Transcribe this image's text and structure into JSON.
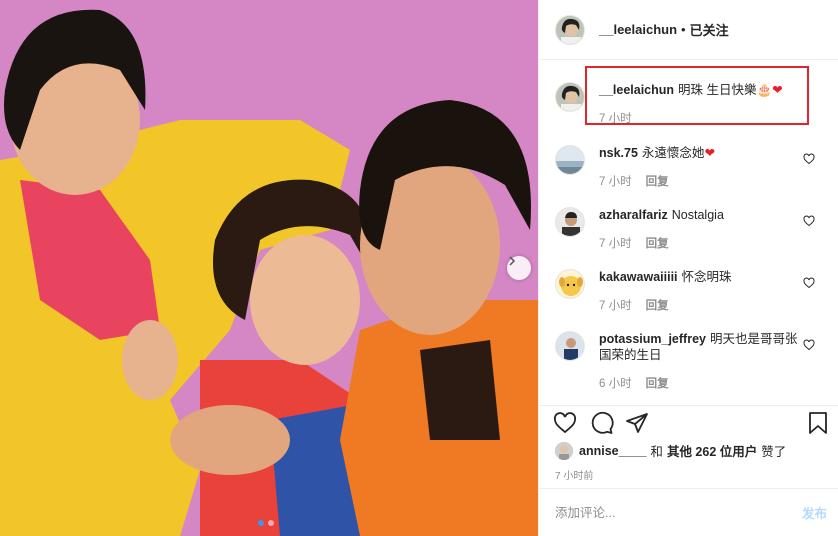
{
  "colors": {
    "accent": "#3897f0",
    "highlight_box": "#e0262b",
    "heart": "#ed1c24"
  },
  "photo": {
    "alt_icon": "photo-post-image",
    "carousel": {
      "count": 3,
      "active": 1
    }
  },
  "header": {
    "username": "__leelaichun",
    "separator": "•",
    "follow_label": "已关注"
  },
  "caption": {
    "username": "__leelaichun",
    "text": "明珠 生日快樂",
    "emoji": "🎂❤",
    "time": "7 小时"
  },
  "comments": [
    {
      "username": "nsk.75",
      "text": "永遠懷念她",
      "emoji": "❤",
      "time": "7 小时",
      "reply": "回复"
    },
    {
      "username": "azharalfariz",
      "text": "Nostalgia",
      "time": "7 小时",
      "reply": "回复"
    },
    {
      "username": "kakawawaiiiii",
      "text": "怀念明珠",
      "time": "7 小时",
      "reply": "回复"
    },
    {
      "username": "potassium_jeffrey",
      "text": "明天也是哥哥张国荣的生日",
      "time": "6 小时",
      "reply": "回复"
    }
  ],
  "likes": {
    "first_user": "annise____",
    "and": "和",
    "others": "其他 262 位用户",
    "suffix": "赞了"
  },
  "post_time": "7 小时前",
  "add_comment": {
    "placeholder": "添加评论...",
    "post_label": "发布"
  }
}
